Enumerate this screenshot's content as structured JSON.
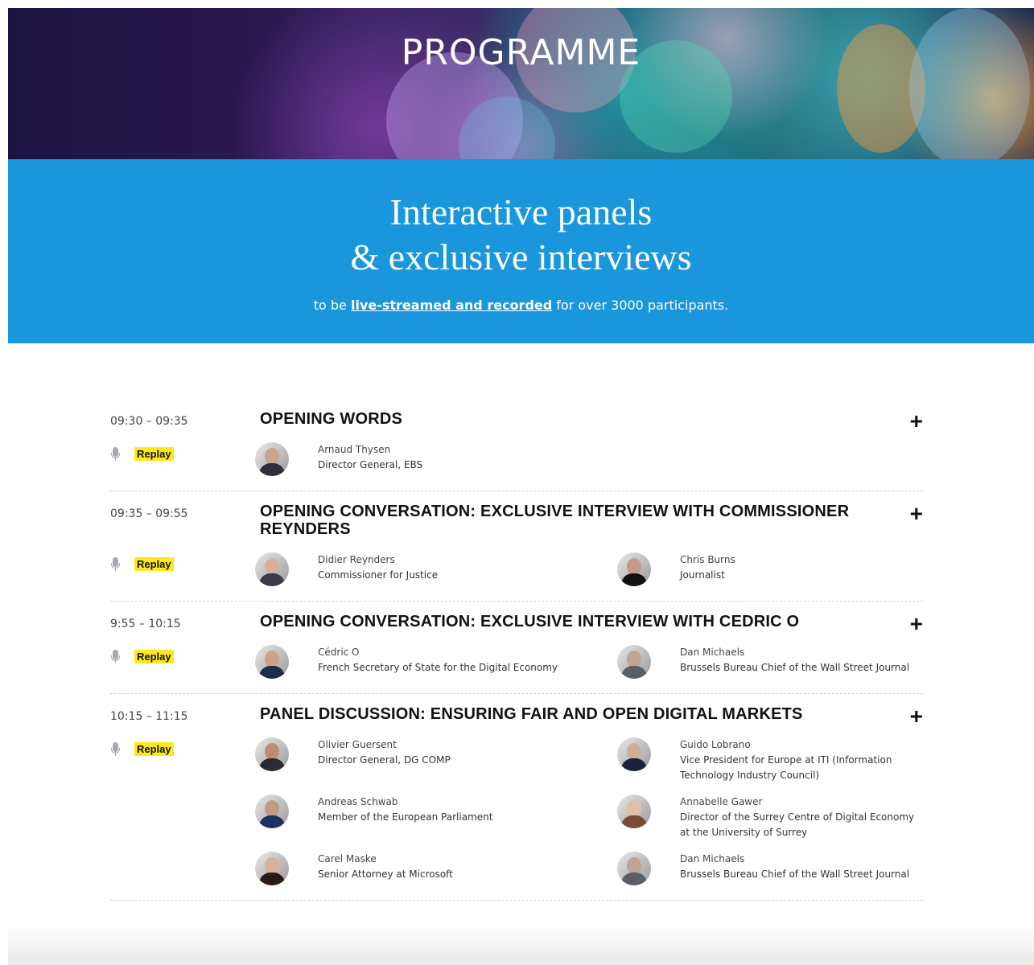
{
  "hero": {
    "title": "PROGRAMME"
  },
  "banner": {
    "heading_line1": "Interactive panels",
    "heading_line2": "& exclusive interviews",
    "sub_prefix": "to be ",
    "sub_link": "live-streamed and recorded",
    "sub_suffix": " for over 3000 participants."
  },
  "colors": {
    "banner_bg": "#1996dc",
    "replay_bg": "#ffe81a"
  },
  "sessions": [
    {
      "time": "09:30 – 09:35",
      "title": "OPENING WORDS",
      "replay": "Replay",
      "speakers": [
        {
          "name": "Arnaud Thysen",
          "role": "Director General, EBS",
          "avatar_tone": "#c9a58c",
          "suit": "#2b2f3a"
        }
      ]
    },
    {
      "time": "09:35 – 09:55",
      "title": "OPENING CONVERSATION: EXCLUSIVE INTERVIEW WITH COMMISSIONER REYNDERS",
      "replay": "Replay",
      "speakers": [
        {
          "name": "Didier Reynders",
          "role": "Commissioner for Justice",
          "avatar_tone": "#d8b09a",
          "suit": "#3a3a48"
        },
        {
          "name": "Chris Burns",
          "role": "Journalist",
          "avatar_tone": "#c49a86",
          "suit": "#111111"
        }
      ]
    },
    {
      "time": "9:55 – 10:15",
      "title": "OPENING CONVERSATION: EXCLUSIVE INTERVIEW WITH CEDRIC O",
      "replay": "Replay",
      "speakers": [
        {
          "name": "Cédric O",
          "role": "French Secretary of State for the Digital Economy",
          "avatar_tone": "#caa28a",
          "suit": "#1e2c4a"
        },
        {
          "name": "Dan Michaels",
          "role": "Brussels Bureau Chief of the Wall Street Journal",
          "avatar_tone": "#bfa596",
          "suit": "#5a5e66"
        }
      ]
    },
    {
      "time": "10:15 – 11:15",
      "title": "PANEL DISCUSSION: ENSURING FAIR AND OPEN DIGITAL MARKETS",
      "replay": "Replay",
      "speakers": [
        {
          "name": "Olivier Guersent",
          "role": "Director General, DG COMP",
          "avatar_tone": "#b88e74",
          "suit": "#2a2a30"
        },
        {
          "name": "Guido Lobrano",
          "role": "Vice President for Europe at ITI (Information Technology Industry Council)",
          "avatar_tone": "#d2ad96",
          "suit": "#18223a"
        },
        {
          "name": "Andreas Schwab",
          "role": "Member of the European Parliament",
          "avatar_tone": "#c29a82",
          "suit": "#1d3160"
        },
        {
          "name": "Annabelle Gawer",
          "role": "Director of the Surrey Centre of Digital Economy at the University of Surrey",
          "avatar_tone": "#e0bfa8",
          "suit": "#7a4a3a"
        },
        {
          "name": "Carel Maske",
          "role": "Senior Attorney at Microsoft",
          "avatar_tone": "#d6b29a",
          "suit": "#2a1a14"
        },
        {
          "name": "Dan Michaels",
          "role": "Brussels Bureau Chief of the Wall Street Journal",
          "avatar_tone": "#bfa596",
          "suit": "#5a5e66"
        }
      ]
    }
  ]
}
